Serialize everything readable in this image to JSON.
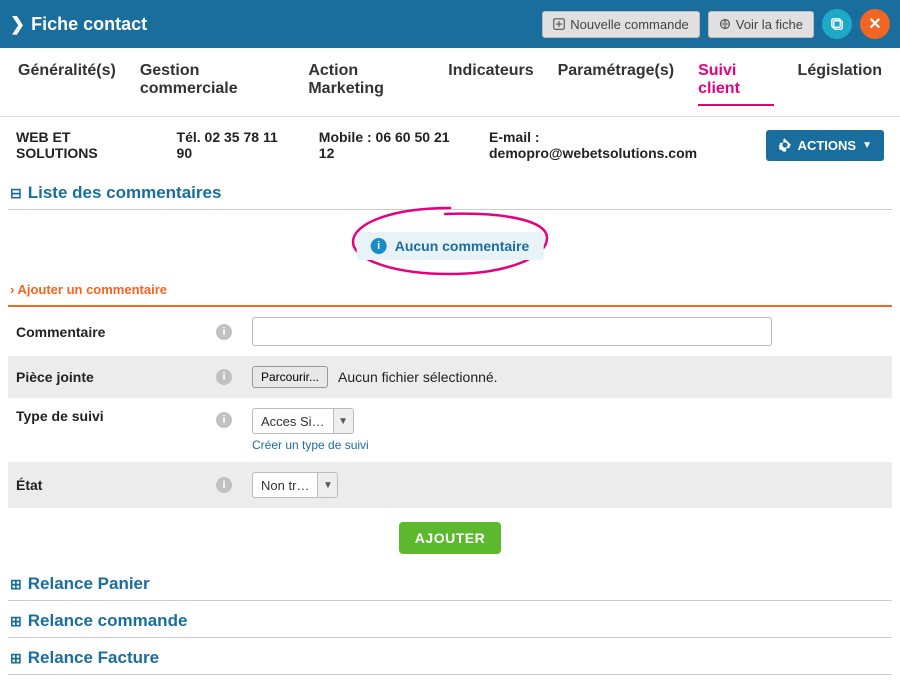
{
  "header": {
    "title": "Fiche contact",
    "new_order_label": "Nouvelle commande",
    "view_label": "Voir la fiche"
  },
  "tabs": [
    {
      "label": "Généralité(s)"
    },
    {
      "label": "Gestion commerciale"
    },
    {
      "label": "Action Marketing"
    },
    {
      "label": "Indicateurs"
    },
    {
      "label": "Paramétrage(s)"
    },
    {
      "label": "Suivi client"
    },
    {
      "label": "Législation"
    }
  ],
  "active_tab_index": 5,
  "info": {
    "company": "WEB ET SOLUTIONS",
    "tel": "Tél. 02 35 78 11 90",
    "mobile": "Mobile : 06 60 50 21 12",
    "email": "E-mail : demopro@webetsolutions.com",
    "actions_label": "ACTIONS"
  },
  "panels": {
    "comments_list": "Liste des commentaires",
    "relance_panier": "Relance Panier",
    "relance_commande": "Relance commande",
    "relance_facture": "Relance Facture"
  },
  "alert": {
    "no_comment": "Aucun commentaire"
  },
  "add_comment": {
    "section_title": "› Ajouter un commentaire",
    "fields": {
      "comment_label": "Commentaire",
      "comment_value": "",
      "attachment_label": "Pièce jointe",
      "browse_label": "Parcourir...",
      "no_file_text": "Aucun fichier sélectionné.",
      "type_label": "Type de suivi",
      "type_value": "Acces Si…",
      "type_create_link": "Créer un type de suivi",
      "state_label": "État",
      "state_value": "Non tr…"
    },
    "submit_label": "AJOUTER"
  }
}
